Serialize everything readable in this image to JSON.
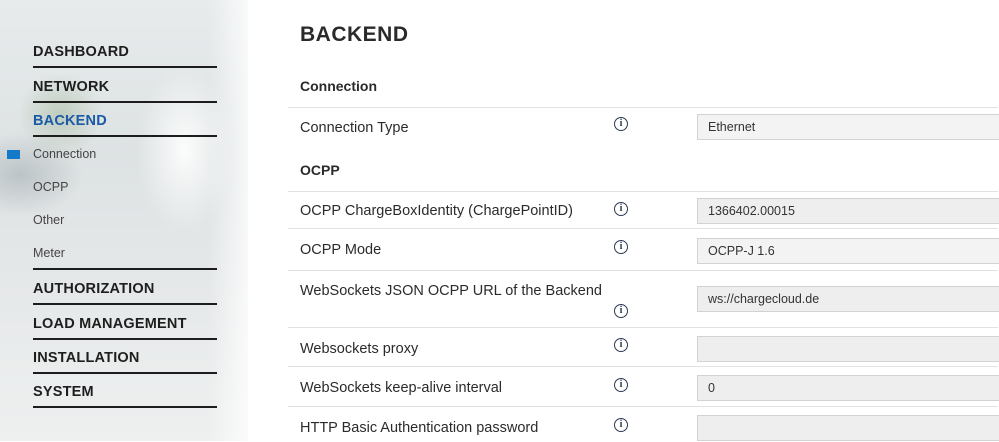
{
  "sidebar": {
    "items": [
      {
        "label": "DASHBOARD"
      },
      {
        "label": "NETWORK"
      },
      {
        "label": "BACKEND"
      },
      {
        "label": "AUTHORIZATION"
      },
      {
        "label": "LOAD MANAGEMENT"
      },
      {
        "label": "INSTALLATION"
      },
      {
        "label": "SYSTEM"
      }
    ],
    "sub_items": [
      {
        "label": "Connection"
      },
      {
        "label": "OCPP"
      },
      {
        "label": "Other"
      },
      {
        "label": "Meter"
      }
    ],
    "active_item": "BACKEND",
    "active_sub_item": "Connection",
    "accent_color": "#1a5aa6",
    "marker_color": "#1479c9"
  },
  "main": {
    "title": "BACKEND",
    "sections": [
      {
        "title": "Connection"
      },
      {
        "title": "OCPP"
      }
    ],
    "rows": [
      {
        "label": "Connection Type",
        "value": "Ethernet",
        "type": "select"
      },
      {
        "label": "OCPP ChargeBoxIdentity (ChargePointID)",
        "value": "1366402.00015",
        "type": "text"
      },
      {
        "label": "OCPP Mode",
        "value": "OCPP-J 1.6",
        "type": "select"
      },
      {
        "label": "WebSockets JSON OCPP URL of the Backend",
        "value": "ws://chargecloud.de",
        "type": "text"
      },
      {
        "label": "Websockets proxy",
        "value": "",
        "type": "text"
      },
      {
        "label": "WebSockets keep-alive interval",
        "value": "0",
        "type": "text"
      },
      {
        "label": "HTTP Basic Authentication password",
        "value": "",
        "type": "password"
      }
    ],
    "info_icon": "info-icon",
    "select_caret_icon": "sort-caret-icon",
    "select_caret_glyph": "⬍"
  }
}
